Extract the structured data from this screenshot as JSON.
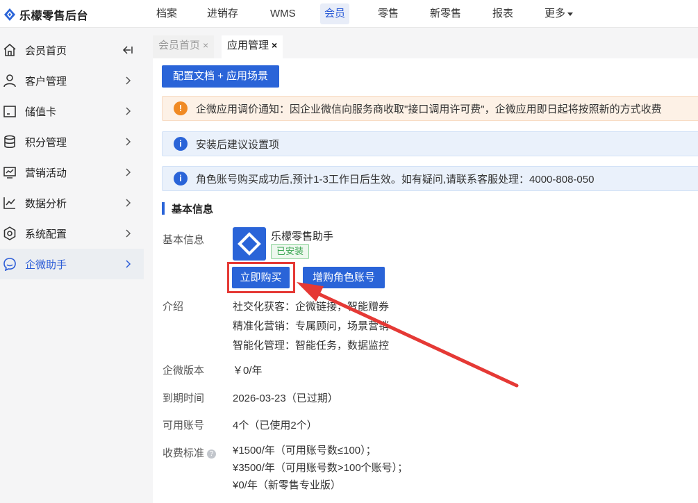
{
  "app": {
    "title": "乐檬零售后台",
    "accent": "#2a64d8"
  },
  "topnav": {
    "items": [
      {
        "label": "档案",
        "active": false
      },
      {
        "label": "进销存",
        "active": false
      },
      {
        "label": "WMS",
        "active": false
      },
      {
        "label": "会员",
        "active": true
      },
      {
        "label": "零售",
        "active": false
      },
      {
        "label": "新零售",
        "active": false
      },
      {
        "label": "报表",
        "active": false
      },
      {
        "label": "更多",
        "active": false
      }
    ]
  },
  "sidebar": {
    "items": [
      {
        "label": "会员首页",
        "icon": "home-icon",
        "trailing": "collapse-icon",
        "active": false
      },
      {
        "label": "客户管理",
        "icon": "user-icon",
        "trailing": "chevron-right-icon",
        "active": false
      },
      {
        "label": "储值卡",
        "icon": "card-icon",
        "trailing": "chevron-right-icon",
        "active": false
      },
      {
        "label": "积分管理",
        "icon": "database-icon",
        "trailing": "chevron-right-icon",
        "active": false
      },
      {
        "label": "营销活动",
        "icon": "monitor-chart-icon",
        "trailing": "chevron-right-icon",
        "active": false
      },
      {
        "label": "数据分析",
        "icon": "line-chart-icon",
        "trailing": "chevron-right-icon",
        "active": false
      },
      {
        "label": "系统配置",
        "icon": "settings-icon",
        "trailing": "chevron-right-icon",
        "active": false
      },
      {
        "label": "企微助手",
        "icon": "chat-icon",
        "trailing": "chevron-right-icon",
        "active": true
      }
    ]
  },
  "tabs": [
    {
      "label": "会员首页",
      "close": "×",
      "active": false
    },
    {
      "label": "应用管理",
      "close": "×",
      "active": true
    }
  ],
  "main": {
    "config_button": "配置文档 + 应用场景",
    "alerts": [
      {
        "type": "warn",
        "icon": "!",
        "text": "企微应用调价通知：因企业微信向服务商收取\"接口调用许可费\"，企微应用即日起将按照新的方式收费"
      },
      {
        "type": "info",
        "icon": "i",
        "text": "安装后建议设置项"
      },
      {
        "type": "info",
        "icon": "i",
        "text": "角色账号购买成功后,预计1-3工作日后生效。如有疑问,请联系客服处理：4000-808-050"
      }
    ],
    "section_title": "基本信息",
    "basic": {
      "label": "基本信息",
      "app_name": "乐檬零售助手",
      "status_badge": "已安装",
      "buy_button": "立即购买",
      "add_account_button": "增购角色账号"
    },
    "intro": {
      "label": "介绍",
      "lines": [
        "社交化获客：企微链接，智能赠券",
        "精准化营销：专属顾问，场景营销",
        "智能化管理：智能任务，数据监控"
      ]
    },
    "version": {
      "label": "企微版本",
      "value": "￥0/年"
    },
    "expire": {
      "label": "到期时间",
      "value": "2026-03-23（已过期）"
    },
    "accounts": {
      "label": "可用账号",
      "value": "4个（已使用2个）"
    },
    "pricing": {
      "label": "收费标准",
      "help": "?",
      "lines": [
        "¥1500/年（可用账号数≤100）；",
        "¥3500/年（可用账号数>100个账号）；",
        "¥0/年（新零售专业版）"
      ]
    }
  }
}
